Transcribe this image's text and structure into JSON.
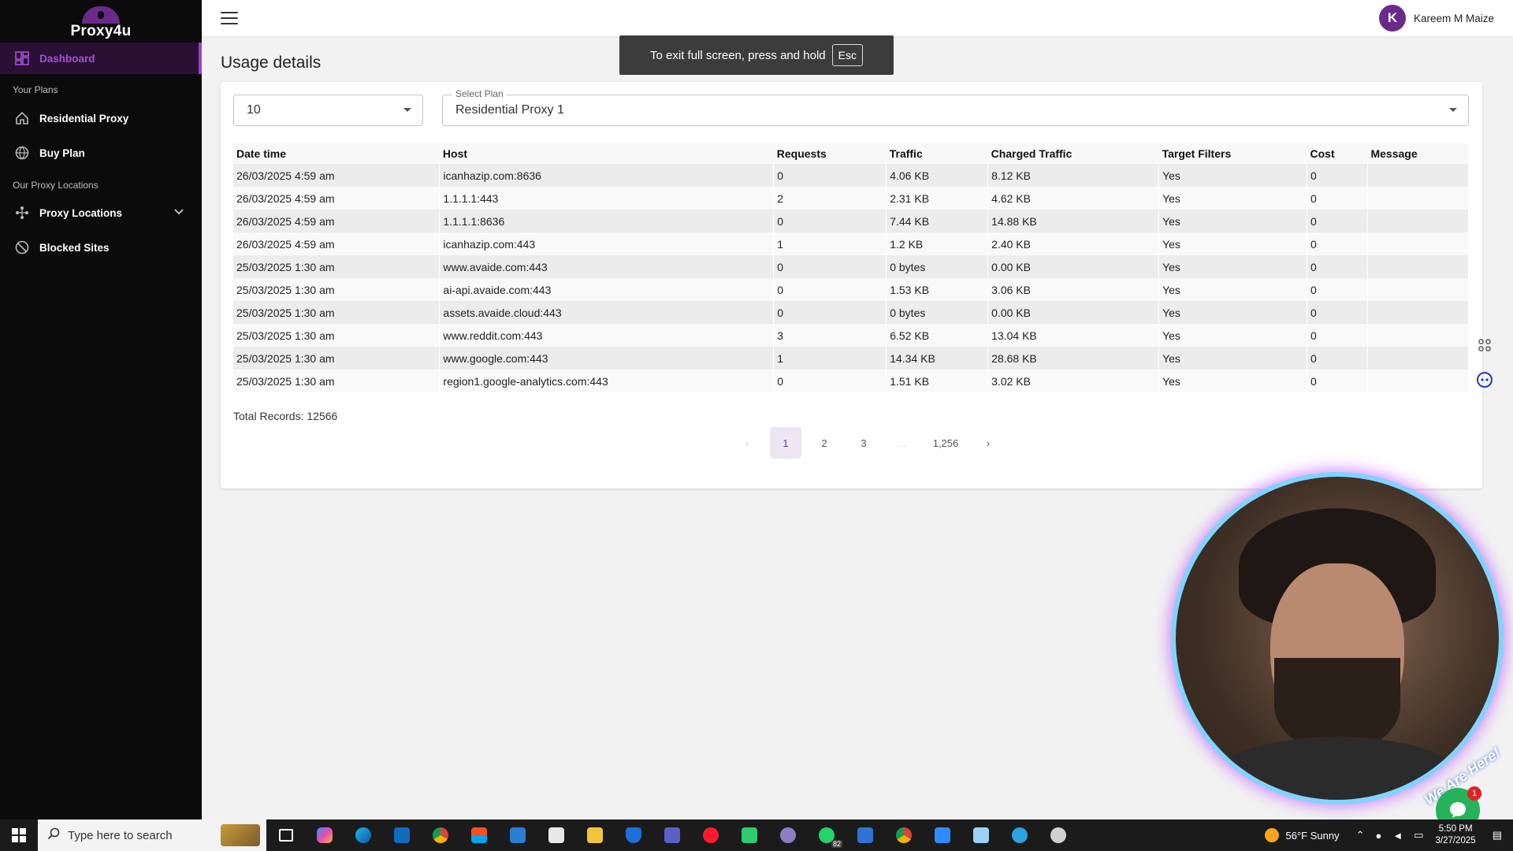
{
  "sidebar": {
    "logo_text": "Proxy4u",
    "dashboard": "Dashboard",
    "section_plans": "Your Plans",
    "residential_proxy": "Residential Proxy",
    "buy_plan": "Buy Plan",
    "section_locations": "Our Proxy Locations",
    "proxy_locations": "Proxy Locations",
    "blocked_sites": "Blocked Sites"
  },
  "header": {
    "avatar_initial": "K",
    "user_name": "Kareem M Maize"
  },
  "fullscreen_toast": {
    "text": "To exit full screen, press and hold",
    "key": "Esc"
  },
  "main": {
    "title": "Usage details",
    "rows_per_page": "10",
    "plan_label": "Select Plan",
    "plan_value": "Residential Proxy 1",
    "columns": [
      "Date time",
      "Host",
      "Requests",
      "Traffic",
      "Charged Traffic",
      "Target Filters",
      "Cost",
      "Message"
    ],
    "rows": [
      [
        "26/03/2025 4:59 am",
        "icanhazip.com:8636",
        "0",
        "4.06 KB",
        "8.12 KB",
        "Yes",
        "0",
        ""
      ],
      [
        "26/03/2025 4:59 am",
        "1.1.1.1:443",
        "2",
        "2.31 KB",
        "4.62 KB",
        "Yes",
        "0",
        ""
      ],
      [
        "26/03/2025 4:59 am",
        "1.1.1.1:8636",
        "0",
        "7.44 KB",
        "14.88 KB",
        "Yes",
        "0",
        ""
      ],
      [
        "26/03/2025 4:59 am",
        "icanhazip.com:443",
        "1",
        "1.2 KB",
        "2.40 KB",
        "Yes",
        "0",
        ""
      ],
      [
        "25/03/2025 1:30 am",
        "www.avaide.com:443",
        "0",
        "0 bytes",
        "0.00 KB",
        "Yes",
        "0",
        ""
      ],
      [
        "25/03/2025 1:30 am",
        "ai-api.avaide.com:443",
        "0",
        "1.53 KB",
        "3.06 KB",
        "Yes",
        "0",
        ""
      ],
      [
        "25/03/2025 1:30 am",
        "assets.avaide.cloud:443",
        "0",
        "0 bytes",
        "0.00 KB",
        "Yes",
        "0",
        ""
      ],
      [
        "25/03/2025 1:30 am",
        "www.reddit.com:443",
        "3",
        "6.52 KB",
        "13.04 KB",
        "Yes",
        "0",
        ""
      ],
      [
        "25/03/2025 1:30 am",
        "www.google.com:443",
        "1",
        "14.34 KB",
        "28.68 KB",
        "Yes",
        "0",
        ""
      ],
      [
        "25/03/2025 1:30 am",
        "region1.google-analytics.com:443",
        "0",
        "1.51 KB",
        "3.02 KB",
        "Yes",
        "0",
        ""
      ]
    ],
    "total_records": "Total Records: 12566",
    "pagination": {
      "prev": "‹",
      "pages": [
        "1",
        "2",
        "3"
      ],
      "ellipsis": "...",
      "last": "1,256",
      "next": "›",
      "current": "1"
    }
  },
  "overlay": {
    "we_are_here": "We Are Here!",
    "chat_badge": "1"
  },
  "taskbar": {
    "search_placeholder": "Type here to search",
    "whatsapp_badge": "82",
    "weather_temp": "56°F",
    "weather_desc": "Sunny",
    "time": "5:50 PM",
    "date": "3/27/2025"
  },
  "colors": {
    "accent": "#9a3fd0",
    "sidebar_bg": "#0b0b0b",
    "avatar": "#6a2a8a"
  }
}
